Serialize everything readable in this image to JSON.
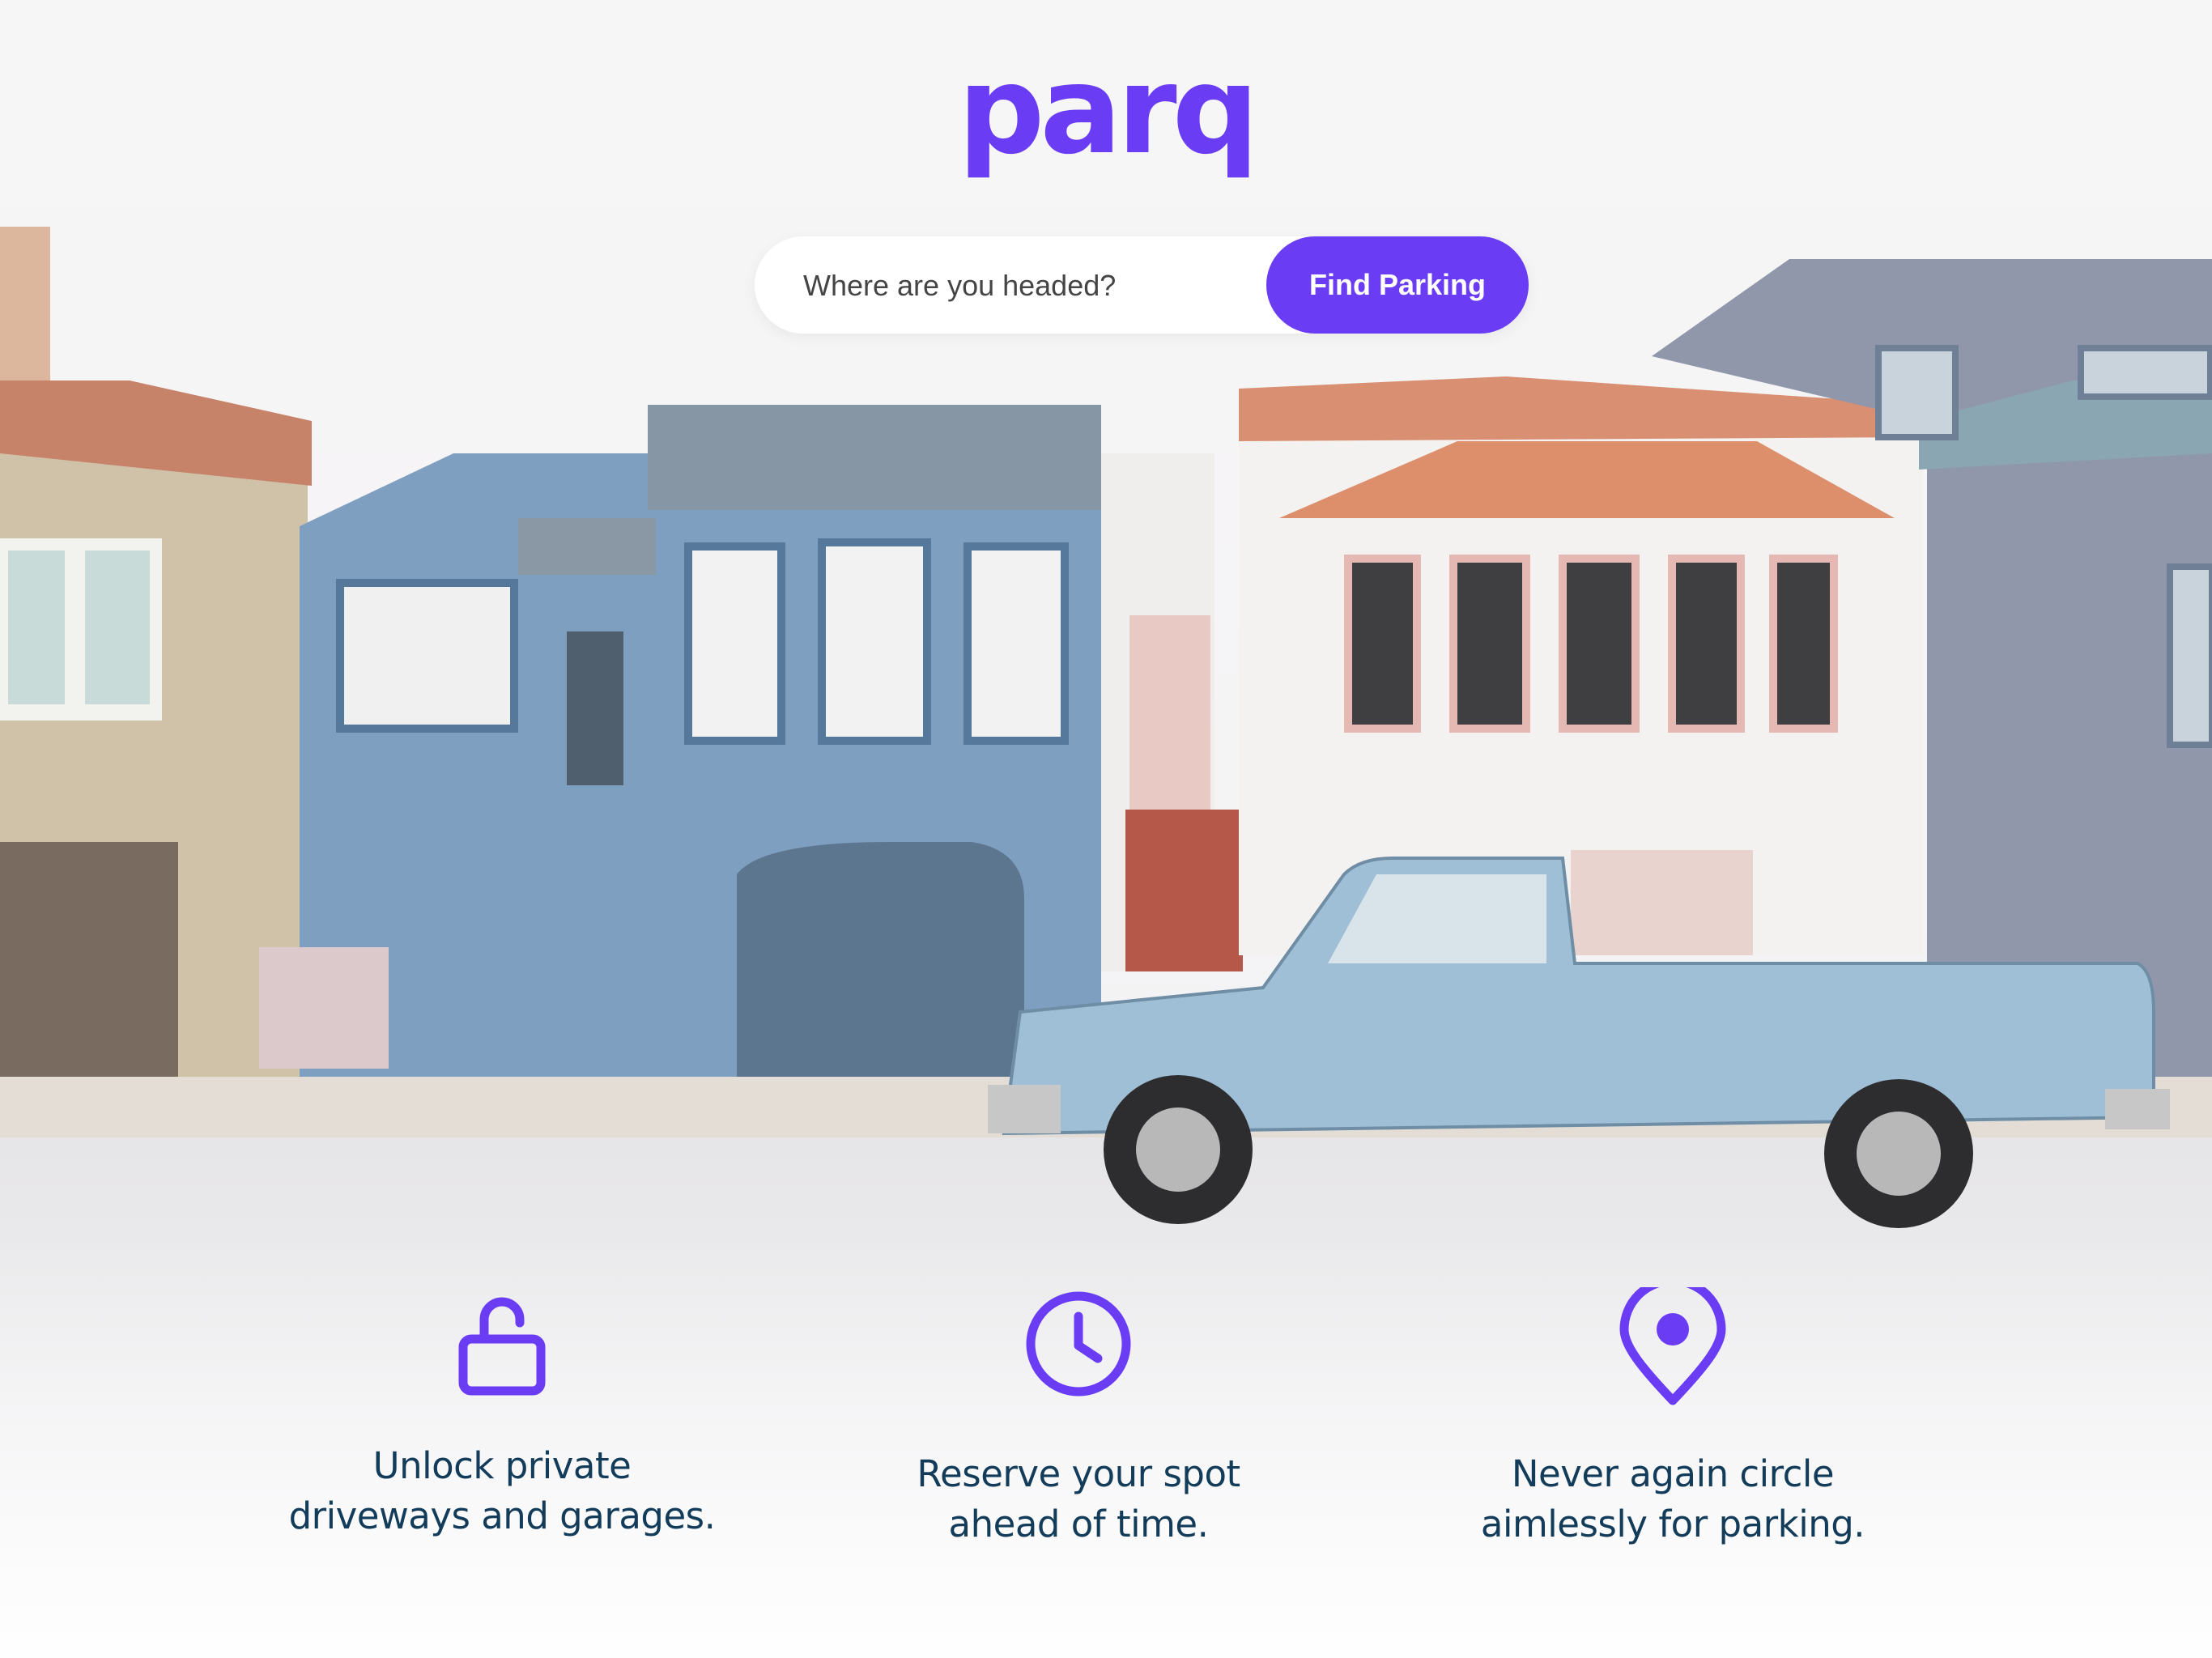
{
  "brand": {
    "logo_text": "parq",
    "accent_color": "#6a3df5"
  },
  "search": {
    "placeholder": "Where are you headed?",
    "value": "",
    "button_label": "Find Parking"
  },
  "features": [
    {
      "icon": "unlock-icon",
      "lines": [
        "Unlock private",
        "driveways and garages."
      ]
    },
    {
      "icon": "clock-icon",
      "lines": [
        "Reserve your spot",
        "ahead of time."
      ]
    },
    {
      "icon": "map-pin-icon",
      "lines": [
        "Never again circle",
        "aimlessly for parking."
      ]
    }
  ],
  "colors": {
    "text": "#123c5a",
    "button_text": "#ffffff"
  }
}
